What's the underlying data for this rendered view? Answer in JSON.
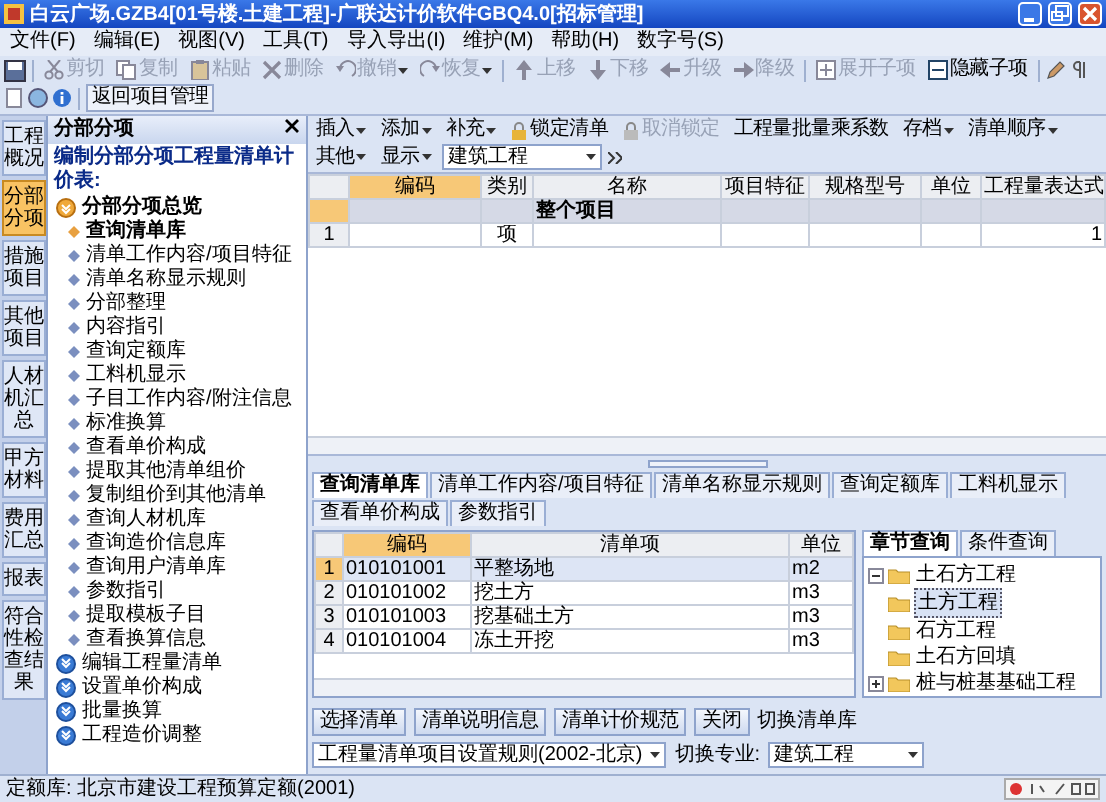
{
  "window": {
    "title": "白云广场.GZB4[01号楼.土建工程]-广联达计价软件GBQ4.0[招标管理]"
  },
  "menu": [
    "文件(F)",
    "编辑(E)",
    "视图(V)",
    "工具(T)",
    "导入导出(I)",
    "维护(M)",
    "帮助(H)",
    "数字号(S)"
  ],
  "toolbar": [
    {
      "label": "剪切",
      "disabled": true,
      "dropdown": false
    },
    {
      "label": "复制",
      "disabled": true,
      "dropdown": false
    },
    {
      "label": "粘贴",
      "disabled": true,
      "dropdown": false
    },
    {
      "label": "删除",
      "disabled": true,
      "dropdown": false
    },
    {
      "label": "撤销",
      "disabled": true,
      "dropdown": true
    },
    {
      "label": "恢复",
      "disabled": true,
      "dropdown": true
    },
    {
      "label": "上移",
      "disabled": true,
      "dropdown": false
    },
    {
      "label": "下移",
      "disabled": true,
      "dropdown": false
    },
    {
      "label": "升级",
      "disabled": true,
      "dropdown": false
    },
    {
      "label": "降级",
      "disabled": true,
      "dropdown": false
    },
    {
      "label": "展开子项",
      "disabled": true,
      "dropdown": false
    },
    {
      "label": "隐藏子项",
      "disabled": false,
      "dropdown": false
    }
  ],
  "return_button": "返回项目管理",
  "side_tabs": [
    {
      "label": "工程概况",
      "selected": false
    },
    {
      "label": "分部分项",
      "selected": true
    },
    {
      "label": "措施项目",
      "selected": false
    },
    {
      "label": "其他项目",
      "selected": false
    },
    {
      "label": "人材机汇总",
      "selected": false
    },
    {
      "label": "甲方材料",
      "selected": false
    },
    {
      "label": "费用汇总",
      "selected": false
    },
    {
      "label": "报表",
      "selected": false
    },
    {
      "label": "符合性检查结果",
      "selected": false
    }
  ],
  "panel": {
    "title": "分部分项",
    "subtitle": "编制分部分项工程量清单计价表:",
    "tree": [
      {
        "label": "分部分项总览",
        "expanded": true,
        "children": [
          {
            "label": "查询清单库",
            "selected": true
          },
          {
            "label": "清单工作内容/项目特征",
            "selected": false
          },
          {
            "label": "清单名称显示规则",
            "selected": false
          },
          {
            "label": "分部整理",
            "selected": false
          },
          {
            "label": "内容指引",
            "selected": false
          },
          {
            "label": "查询定额库",
            "selected": false
          },
          {
            "label": "工料机显示",
            "selected": false
          },
          {
            "label": "子目工作内容/附注信息",
            "selected": false
          },
          {
            "label": "标准换算",
            "selected": false
          },
          {
            "label": "查看单价构成",
            "selected": false
          },
          {
            "label": "提取其他清单组价",
            "selected": false
          },
          {
            "label": "复制组价到其他清单",
            "selected": false
          },
          {
            "label": "查询人材机库",
            "selected": false
          },
          {
            "label": "查询造价信息库",
            "selected": false
          },
          {
            "label": "查询用户清单库",
            "selected": false
          },
          {
            "label": "参数指引",
            "selected": false
          },
          {
            "label": "提取模板子目",
            "selected": false
          },
          {
            "label": "查看换算信息",
            "selected": false
          }
        ]
      },
      {
        "label": "编辑工程量清单",
        "expanded": false
      },
      {
        "label": "设置单价构成",
        "expanded": false
      },
      {
        "label": "批量换算",
        "expanded": false
      },
      {
        "label": "工程造价调整",
        "expanded": false
      }
    ]
  },
  "main_toolbar": [
    {
      "kind": "menu",
      "label": "插入",
      "disabled": false
    },
    {
      "kind": "menu",
      "label": "添加",
      "disabled": false
    },
    {
      "kind": "menu",
      "label": "补充",
      "disabled": false
    },
    {
      "kind": "button",
      "label": "锁定清单",
      "disabled": false
    },
    {
      "kind": "button",
      "label": "取消锁定",
      "disabled": true
    },
    {
      "kind": "button",
      "label": "工程量批量乘系数",
      "disabled": false
    },
    {
      "kind": "menu",
      "label": "存档",
      "disabled": false
    },
    {
      "kind": "menu",
      "label": "清单顺序",
      "disabled": false
    },
    {
      "kind": "menu",
      "label": "其他",
      "disabled": false
    },
    {
      "kind": "menu",
      "label": "显示",
      "disabled": false
    },
    {
      "kind": "select",
      "label": "建筑工程"
    }
  ],
  "table": {
    "columns": [
      {
        "label": "编码",
        "selected": true
      },
      {
        "label": "类别",
        "selected": false
      },
      {
        "label": "名称",
        "selected": false
      },
      {
        "label": "项目特征",
        "selected": false
      },
      {
        "label": "规格型号",
        "selected": false
      },
      {
        "label": "单位",
        "selected": false
      },
      {
        "label": "工程量表达式",
        "selected": false
      }
    ],
    "rows": [
      {
        "kind": "group",
        "number": "",
        "cells": [
          "",
          "",
          "整个项目",
          "",
          "",
          "",
          ""
        ]
      },
      {
        "kind": "item",
        "number": "1",
        "cells": [
          "",
          "项",
          "",
          "",
          "",
          "",
          "1"
        ]
      }
    ]
  },
  "bottom_tabs": [
    {
      "label": "查询清单库",
      "selected": true
    },
    {
      "label": "清单工作内容/项目特征",
      "selected": false
    },
    {
      "label": "清单名称显示规则",
      "selected": false
    },
    {
      "label": "查询定额库",
      "selected": false
    },
    {
      "label": "工料机显示",
      "selected": false
    },
    {
      "label": "查看单价构成",
      "selected": false
    },
    {
      "label": "参数指引",
      "selected": false
    }
  ],
  "library_grid": {
    "columns": [
      {
        "label": "编码",
        "selected": true
      },
      {
        "label": "清单项",
        "selected": false
      },
      {
        "label": "单位",
        "selected": false
      }
    ],
    "rows": [
      {
        "number": "1",
        "code": "010101001",
        "name": "平整场地",
        "unit": "m2",
        "selected": true
      },
      {
        "number": "2",
        "code": "010101002",
        "name": "挖土方",
        "unit": "m3",
        "selected": false
      },
      {
        "number": "3",
        "code": "010101003",
        "name": "挖基础土方",
        "unit": "m3",
        "selected": false
      },
      {
        "number": "4",
        "code": "010101004",
        "name": "冻土开挖",
        "unit": "m3",
        "selected": false
      }
    ]
  },
  "tree_tabs": [
    {
      "label": "章节查询",
      "selected": true
    },
    {
      "label": "条件查询",
      "selected": false
    }
  ],
  "chapter_tree": [
    {
      "label": "土石方工程",
      "expanded": true,
      "children": [
        {
          "label": "土方工程",
          "selected": true
        },
        {
          "label": "石方工程",
          "selected": false
        },
        {
          "label": "土石方回填",
          "selected": false
        }
      ]
    },
    {
      "label": "桩与桩基基础工程",
      "expanded": false
    }
  ],
  "footer_buttons": [
    "选择清单",
    "清单说明信息",
    "清单计价规范",
    "关闭"
  ],
  "switch_library": {
    "label": "切换清单库",
    "value": "工程量清单项目设置规则(2002-北京)"
  },
  "switch_specialty": {
    "label": "切换专业:",
    "value": "建筑工程"
  },
  "status_bar": {
    "text": "定额库: 北京市建设工程预算定额(2001)"
  }
}
